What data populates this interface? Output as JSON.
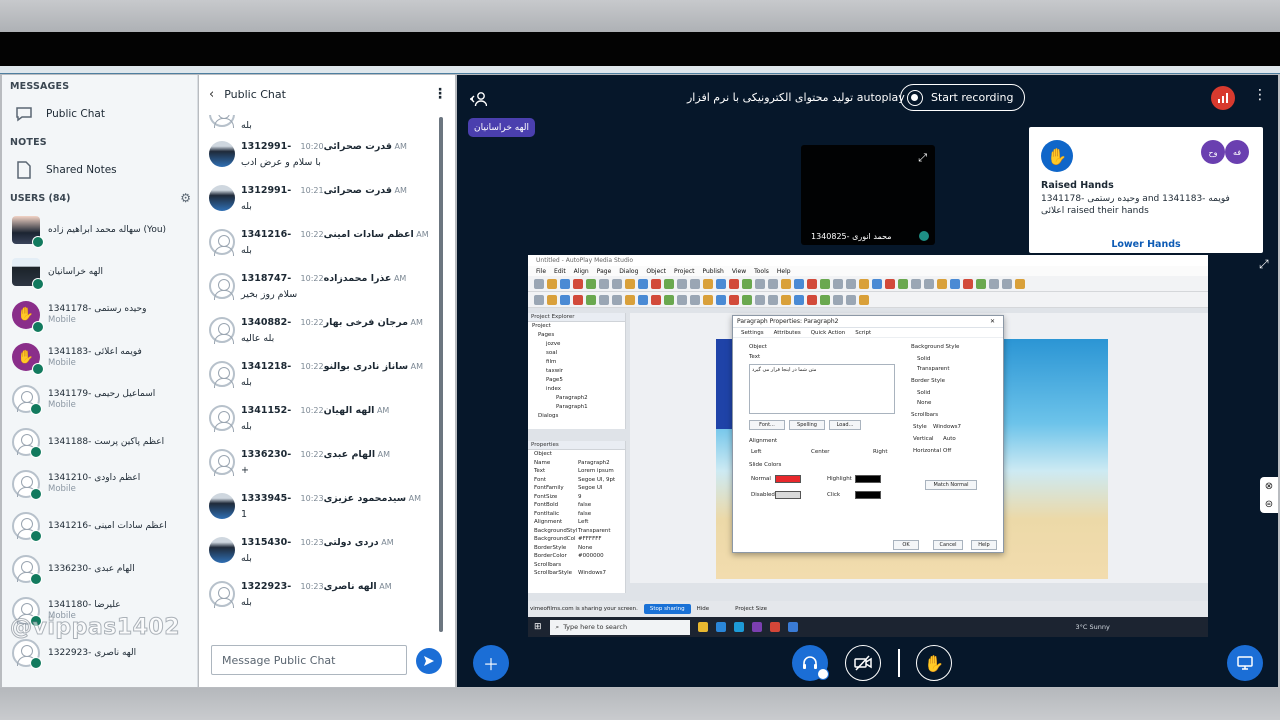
{
  "sidebar": {
    "messages_heading": "MESSAGES",
    "public_chat": "Public Chat",
    "notes_heading": "NOTES",
    "shared_notes": "Shared Notes",
    "users_heading": "USERS (84)",
    "users": [
      {
        "name": "سهاله محمد ابراهیم زاده (You)",
        "sub": "",
        "avatar": "photo"
      },
      {
        "name": "الهه خراسانیان",
        "sub": "",
        "avatar": "photo2"
      },
      {
        "name": "1341178- وحیده رستمی",
        "sub": "Mobile",
        "avatar": "hand"
      },
      {
        "name": "1341183- فویمه اعلائی",
        "sub": "Mobile",
        "avatar": "hand"
      },
      {
        "name": "1341179- اسماعیل رحیمی",
        "sub": "Mobile",
        "avatar": "ph"
      },
      {
        "name": "1341188- اعظم پاکین پرست",
        "sub": "",
        "avatar": "ph"
      },
      {
        "name": "1341210- اعظم داودی",
        "sub": "Mobile",
        "avatar": "ph"
      },
      {
        "name": "1341216- اعظم سادات امینی",
        "sub": "",
        "avatar": "ph"
      },
      {
        "name": "1336230- الهام عبدی",
        "sub": "",
        "avatar": "ph"
      },
      {
        "name": "1341180- علیرضا",
        "sub": "Mobile",
        "avatar": "ph"
      },
      {
        "name": "1322923- الهه ناصری",
        "sub": "",
        "avatar": "ph"
      }
    ],
    "watermark": "@vippas1402"
  },
  "chat": {
    "title": "Public Chat",
    "messages": [
      {
        "name": "",
        "time": "",
        "text": "بله",
        "avatar": "ph"
      },
      {
        "name": "1312991- قدرت صحرائی",
        "time": "10:20 AM",
        "text": "با سلام و عرض ادب",
        "avatar": "photo3"
      },
      {
        "name": "1312991- قدرت صحرائی",
        "time": "10:21 AM",
        "text": "بله",
        "avatar": "photo3"
      },
      {
        "name": "1341216- اعظم سادات امینی",
        "time": "10:22 AM",
        "text": "بله",
        "avatar": "ph"
      },
      {
        "name": "1318747- عذرا محمدزاده",
        "time": "10:22 AM",
        "text": "سلام روز بخیر",
        "avatar": "ph"
      },
      {
        "name": "1340882- مرجان فرخی بهار",
        "time": "10:22 AM",
        "text": "بله عالیه",
        "avatar": "ph"
      },
      {
        "name": "1341218- ساناز نادری بوالنو",
        "time": "10:22 AM",
        "text": "بله",
        "avatar": "ph"
      },
      {
        "name": "1341152- الهه الهیان",
        "time": "10:22 AM",
        "text": "بله",
        "avatar": "ph"
      },
      {
        "name": "1336230- الهام عبدی",
        "time": "10:22 AM",
        "text": "+",
        "avatar": "ph"
      },
      {
        "name": "1333945- سیدمحمود عزیزی",
        "time": "10:23 AM",
        "text": "1",
        "avatar": "photo4"
      },
      {
        "name": "1315430- دردی دولتی",
        "time": "10:23 AM",
        "text": "بله",
        "avatar": "photo5"
      },
      {
        "name": "1322923- الهه ناصری",
        "time": "10:23 AM",
        "text": "بله",
        "avatar": "ph"
      }
    ],
    "input_placeholder": "Message Public Chat"
  },
  "main": {
    "meeting_title": "تولید محتوای الکترونیکی با نرم افزار autoplay",
    "start_recording": "Start recording",
    "presenter": "الهه خراسانیان",
    "webcam_label": "1340825- محمد انوری",
    "raised": {
      "title": "Raised Hands",
      "desc": "1341178- وحیده رستمی and 1341183- فویمه اعلائی raised their hands",
      "button": "Lower Hands",
      "mini1": "وح",
      "mini2": "فه"
    },
    "share": {
      "window_title": "Untitled - AutoPlay Media Studio",
      "menus": [
        "File",
        "Edit",
        "Align",
        "Page",
        "Dialog",
        "Object",
        "Project",
        "Publish",
        "View",
        "Tools",
        "Help"
      ],
      "project_explorer": "Project Explorer",
      "tree": [
        "Project",
        "Pages",
        "jozve",
        "soal",
        "film",
        "taxwir",
        "Page5",
        "index",
        "Paragraph2",
        "Paragraph1",
        "Dialogs"
      ],
      "properties": "Properties",
      "prop_rows": [
        [
          "Object",
          ""
        ],
        [
          "Name",
          "Paragraph2"
        ],
        [
          "Text",
          "Lorem ipsum"
        ],
        [
          "Font",
          "Segoe UI, 9pt"
        ],
        [
          "FontFamily",
          "Segoe UI"
        ],
        [
          "FontSize",
          "9"
        ],
        [
          "FontBold",
          "false"
        ],
        [
          "FontItalic",
          "false"
        ],
        [
          "Alignment",
          "Left"
        ],
        [
          "BackgroundStyl",
          "Transparent"
        ],
        [
          "BackgroundCol",
          "#FFFFFF"
        ],
        [
          "BorderStyle",
          "None"
        ],
        [
          "BorderColor",
          "#000000"
        ],
        [
          "Scrollbars",
          ""
        ],
        [
          "ScrollbarStyle",
          "Windows7"
        ]
      ],
      "dialog_title": "Paragraph Properties: Paragraph2",
      "dialog_tabs": [
        "Settings",
        "Attributes",
        "Quick Action",
        "Script"
      ],
      "object_label": "Object",
      "text_label": "Text",
      "text_value": "متن شما در اینجا قرار می گیرد",
      "font_btn": "Font...",
      "spelling_btn": "Spelling",
      "load_btn": "Load...",
      "alignment_label": "Alignment",
      "align_left": "Left",
      "align_center": "Center",
      "align_right": "Right",
      "bg_style_label": "Background Style",
      "solid": "Solid",
      "transparent": "Transparent",
      "border_style_label": "Border Style",
      "none": "None",
      "scrollbars_label": "Scrollbars",
      "style_label": "Style",
      "style_value": "Windows7",
      "vertical_label": "Vertical",
      "vertical_value": "Auto",
      "horizontal_label": "Horizontal",
      "horizontal_value": "Off",
      "slide_colors": "Slide Colors",
      "normal": "Normal",
      "disabled": "Disabled",
      "highlight": "Highlight",
      "click": "Click",
      "match_normal": "Match Normal",
      "ok": "OK",
      "cancel": "Cancel",
      "help": "Help",
      "sharing_text": "vimeofilms.com is sharing your screen.",
      "stop_sharing": "Stop sharing",
      "hide": "Hide",
      "project_size": "Project Size",
      "taskbar_search": "Type here to search",
      "weather": "3°C  Sunny",
      "colors": {
        "red": "#e8282c",
        "black": "#000000"
      }
    }
  },
  "colors": {
    "accent": "#1b6ed6",
    "dark_bg": "#06172a",
    "hand": "#8a2e8a"
  }
}
